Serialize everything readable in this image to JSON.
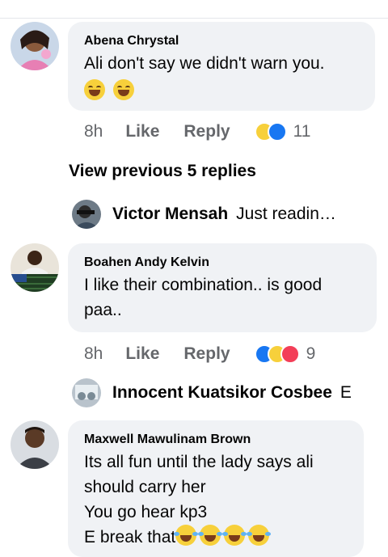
{
  "comments": [
    {
      "author": "Abena Chrystal",
      "text": "Ali don't say we didn't warn you.",
      "emoji": [
        "grinning-sweat-icon",
        "grinning-icon"
      ],
      "time": "8h",
      "like": "Like",
      "reply": "Reply",
      "reactions": [
        "haha-icon",
        "like-icon"
      ],
      "reaction_count": "11"
    },
    {
      "author": "Boahen Andy Kelvin",
      "text": "I like their combination.. is good\npaa..",
      "time": "8h",
      "like": "Like",
      "reply": "Reply",
      "reactions": [
        "like-icon",
        "haha-icon",
        "love-icon"
      ],
      "reaction_count": "9"
    },
    {
      "author": "Maxwell Mawulinam Brown",
      "text": "Its all fun until the lady says ali\nshould carry her\nYou go hear kp3\nE break that",
      "emoji": [
        "joy-icon",
        "joy-icon",
        "joy-icon",
        "joy-icon"
      ]
    }
  ],
  "view_previous": "View previous 5 replies",
  "replies": [
    {
      "name": "Victor Mensah",
      "preview": "Just readin…"
    },
    {
      "name": "Innocent Kuatsikor Cosbee",
      "preview": "E"
    }
  ],
  "colors": {
    "bubble": "#f0f2f5",
    "secondary_text": "#65676b",
    "like_blue": "#1877f2",
    "love_red": "#f33e58",
    "haha_yellow": "#f7d03b"
  }
}
